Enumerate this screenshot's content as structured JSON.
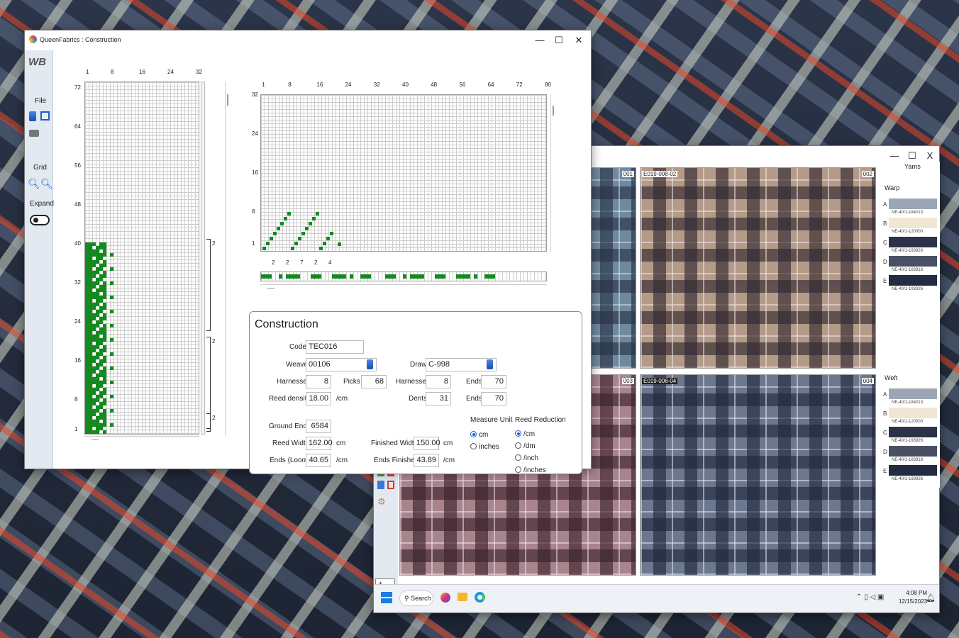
{
  "front_window": {
    "title": "QueenFabrics : Construction",
    "controls": {
      "minimize": "—",
      "maximize": "☐",
      "close": "✕"
    }
  },
  "sidebar": {
    "logo": "WB",
    "file_label": "File",
    "grid_label": "Grid",
    "expand_label": "Expand"
  },
  "left_grid": {
    "x_ticks": [
      "1",
      "8",
      "16",
      "24",
      "32"
    ],
    "y_ticks": [
      "72",
      "64",
      "56",
      "48",
      "40",
      "32",
      "24",
      "16",
      "8",
      "1"
    ],
    "right_marks": [
      "2",
      "2",
      "2"
    ]
  },
  "weave_grid": {
    "x_ticks": [
      "1",
      "8",
      "16",
      "24",
      "32",
      "40",
      "48",
      "56",
      "64",
      "72",
      "80"
    ],
    "y_ticks": [
      "32",
      "24",
      "16",
      "8",
      "1"
    ],
    "bottom_ticks": [
      "2",
      "2",
      "7",
      "2",
      "4"
    ]
  },
  "construction": {
    "title": "Construction",
    "code_label": "Code",
    "code_value": "TEC016",
    "weave_label": "Weave",
    "weave_value": "00106",
    "draw_label": "Draw",
    "draw_value": "C-998",
    "harnesses_label": "Harnesses",
    "harnesses_value": "8",
    "picks_label": "Picks",
    "picks_value": "68",
    "harnesses2_label": "Harnesses",
    "harnesses2_value": "8",
    "ends_label": "Ends",
    "ends_value": "70",
    "reed_density_label": "Reed density",
    "reed_density_value": "18.00",
    "reed_density_unit": "/cm",
    "dents_label": "Dents",
    "dents_value": "31",
    "ends2_label": "Ends",
    "ends2_value": "70",
    "ground_ends_label": "Ground Ends",
    "ground_ends_value": "6584",
    "reed_width_label": "Reed Width",
    "reed_width_value": "162.00",
    "reed_width_unit": "cm",
    "finished_width_label": "Finished Width",
    "finished_width_value": "150.00",
    "finished_width_unit": "cm",
    "ends_loom_label": "Ends (Loom)",
    "ends_loom_value": "40.65",
    "ends_loom_unit": "/cm",
    "ends_finished_label": "Ends Finished",
    "ends_finished_value": "43.89",
    "ends_finished_unit": "/cm",
    "measure_unit_label": "Measure Unit",
    "measure_options": [
      "cm",
      "inches"
    ],
    "reed_reduction_label": "Reed Reduction",
    "reed_options": [
      "/cm",
      "/dm",
      "/inch",
      "/inches"
    ]
  },
  "back_window": {
    "controls": {
      "minimize": "—",
      "maximize": "☐",
      "close": "X"
    },
    "tiles": [
      {
        "name": "",
        "num": "001"
      },
      {
        "name": "E019-008-02",
        "num": "002"
      },
      {
        "name": "",
        "num": "003"
      },
      {
        "name": "E019-008-04",
        "num": "004"
      }
    ],
    "yarns_title": "Yarns",
    "warp_label": "Warp",
    "weft_label": "Weft",
    "warp": [
      {
        "letter": "A",
        "name": "NE-40/1-184013",
        "color": "#9aa6b3"
      },
      {
        "letter": "B",
        "name": "NE-40/1-120000",
        "color": "#efe7d3"
      },
      {
        "letter": "C",
        "name": "NE-40/1-193926",
        "color": "#2c3348"
      },
      {
        "letter": "D",
        "name": "NE-40/1-183918",
        "color": "#4a5063"
      },
      {
        "letter": "E",
        "name": "NE-40/1-193926",
        "color": "#252b40"
      }
    ],
    "weft": [
      {
        "letter": "A",
        "name": "NE-40/1-184013",
        "color": "#9aa6b3"
      },
      {
        "letter": "B",
        "name": "NE-40/1-120000",
        "color": "#efe7d3"
      },
      {
        "letter": "C",
        "name": "NE-40/1-193926",
        "color": "#2c3348"
      },
      {
        "letter": "D",
        "name": "NE-40/1-183918",
        "color": "#4a5063"
      },
      {
        "letter": "E",
        "name": "NE-40/1-193926",
        "color": "#252b40"
      }
    ],
    "selector_value": "4"
  },
  "taskbar": {
    "search_label": "Search",
    "time": "4:08 PM",
    "date": "12/15/2023"
  }
}
